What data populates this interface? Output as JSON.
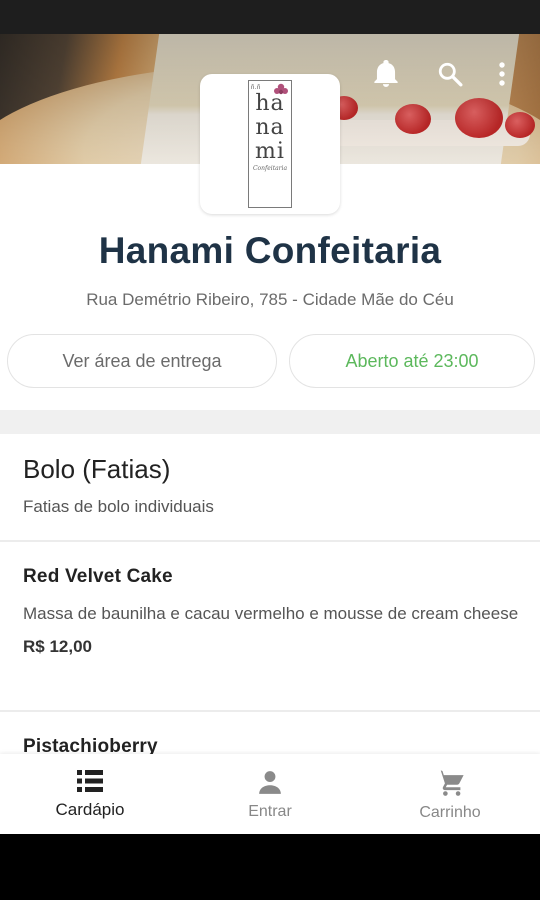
{
  "store": {
    "name": "Hanami Confeitaria",
    "address": "Rua Demétrio Ribeiro, 785 - Cidade Mãe do Céu",
    "delivery_area_label": "Ver área de entrega",
    "open_status": "Aberto até 23:00"
  },
  "logo": {
    "top_small_text": "ñ.ñ",
    "word_lines": [
      "ha",
      "na",
      "mi"
    ],
    "sub_text": "Confeitaria"
  },
  "header_icons": [
    "bell-icon",
    "search-icon",
    "more-vert-icon"
  ],
  "section": {
    "title": "Bolo (Fatias)",
    "subtitle": "Fatias de bolo individuais"
  },
  "products": [
    {
      "name": "Red Velvet Cake",
      "description": "Massa de baunilha e cacau vermelho e mousse de cream cheese",
      "price": "R$ 12,00"
    },
    {
      "name": "Pistachioberry"
    }
  ],
  "bottom_nav": {
    "items": [
      {
        "label": "Cardápio",
        "icon": "menu-list-icon",
        "active": true
      },
      {
        "label": "Entrar",
        "icon": "person-icon",
        "active": false
      },
      {
        "label": "Carrinho",
        "icon": "cart-icon",
        "active": false
      }
    ]
  },
  "colors": {
    "title": "#1f3346",
    "open_status": "#5cb85c",
    "muted_text": "#6b6b6b",
    "logo_flower": "#b0507a"
  }
}
